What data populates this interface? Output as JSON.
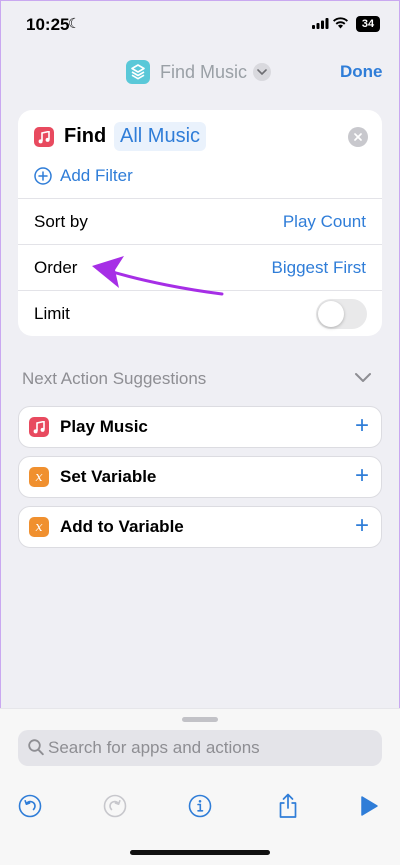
{
  "status_bar": {
    "time": "10:25",
    "battery": "34"
  },
  "nav": {
    "title": "Find Music",
    "done_label": "Done"
  },
  "action": {
    "find_label": "Find",
    "source": "All Music",
    "add_filter_label": "Add Filter",
    "sort_by": {
      "label": "Sort by",
      "value": "Play Count"
    },
    "order": {
      "label": "Order",
      "value": "Biggest First"
    },
    "limit": {
      "label": "Limit",
      "enabled": false
    }
  },
  "suggestions": {
    "header": "Next Action Suggestions",
    "items": [
      {
        "label": "Play Music",
        "icon": "music-icon",
        "color": "#e84a5f"
      },
      {
        "label": "Set Variable",
        "icon": "variable-icon",
        "color": "#f0902f"
      },
      {
        "label": "Add to Variable",
        "icon": "variable-icon",
        "color": "#f0902f"
      }
    ]
  },
  "search": {
    "placeholder": "Search for apps and actions"
  },
  "colors": {
    "accent": "#2f7dd8",
    "annotation_arrow": "#a62ee6"
  }
}
